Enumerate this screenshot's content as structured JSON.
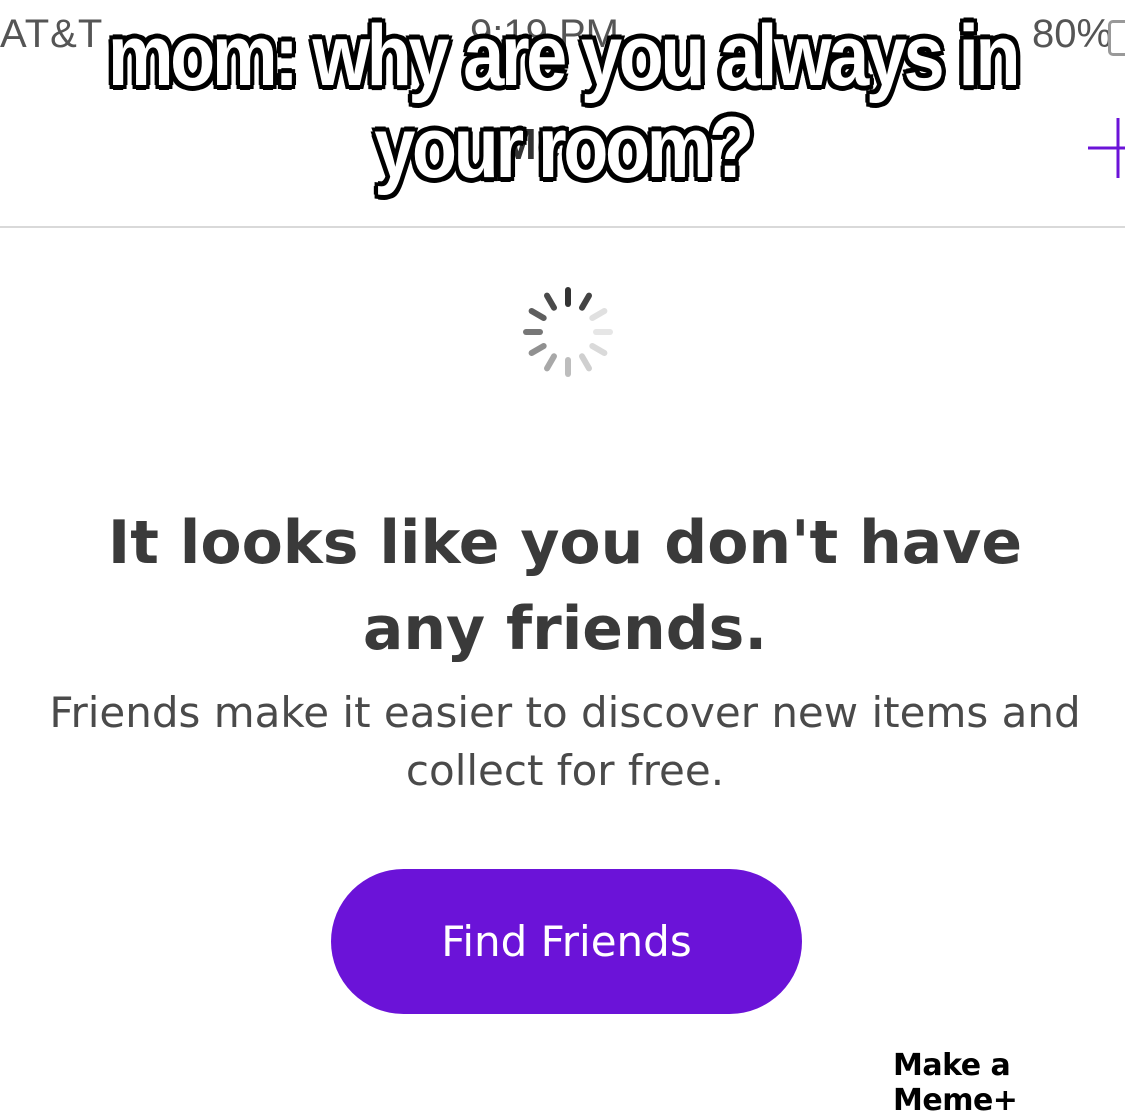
{
  "status_bar": {
    "carrier": "AT&T",
    "time": "9:19 PM",
    "battery": "80%"
  },
  "nav": {
    "title": "Me"
  },
  "meme": {
    "caption": "mom: why are you always in your room?",
    "watermark": "Make a Meme+"
  },
  "empty_state": {
    "headline_line1": "It looks like you don't have",
    "headline_line2": "any friends.",
    "subtext_line1": "Friends make it easier to discover new items and",
    "subtext_line2": "collect for free.",
    "button_label": "Find Friends"
  },
  "colors": {
    "accent": "#6b13d8",
    "text_dark": "#3a3a3a",
    "text_body": "#4a4a4a",
    "divider": "#d9d9d9"
  },
  "icons": {
    "loading": "spinner-icon",
    "add": "plus-icon"
  }
}
